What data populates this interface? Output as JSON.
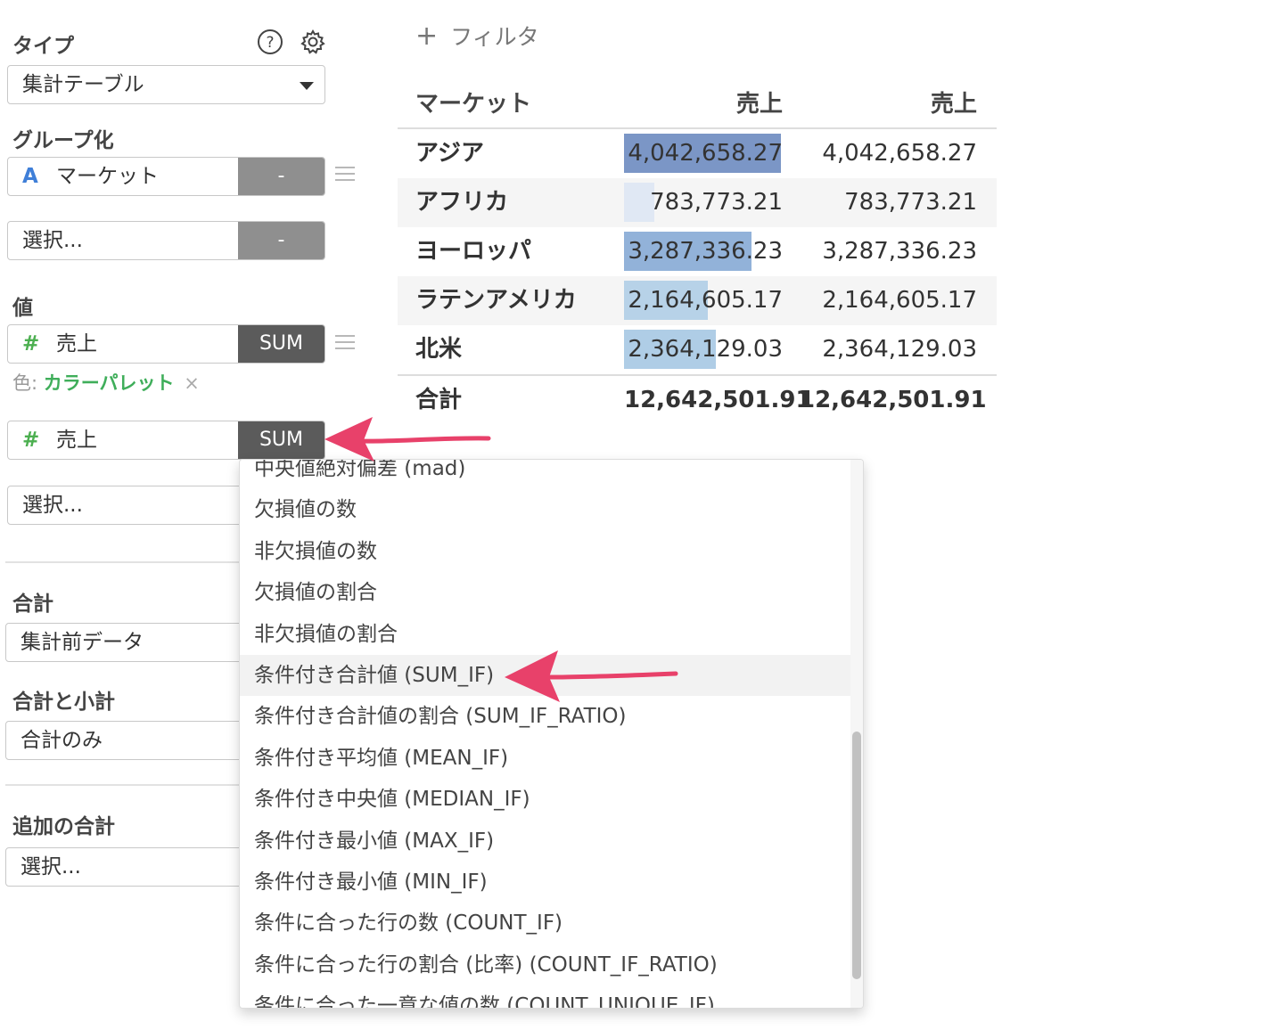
{
  "panel": {
    "type_label": "タイプ",
    "type_value": "集計テーブル",
    "group_label": "グループ化",
    "group_field": {
      "type_icon": "A",
      "name": "マーケット",
      "agg": "-"
    },
    "group_select": {
      "placeholder": "選択...",
      "agg": "-"
    },
    "value_label": "値",
    "value_field1": {
      "type_icon": "#",
      "name": "売上",
      "agg": "SUM"
    },
    "color_prefix": "色: ",
    "color_value": "カラーパレット",
    "color_remove": "×",
    "value_field2": {
      "type_icon": "#",
      "name": "売上",
      "agg": "SUM"
    },
    "value_select": {
      "placeholder": "選択..."
    },
    "total_label": "合計",
    "total_value": "集計前データ",
    "subtotal_label": "合計と小計",
    "subtotal_value": "合計のみ",
    "extra_total_label": "追加の合計",
    "extra_total_value": "選択..."
  },
  "filter": {
    "icon": "+",
    "label": "フィルタ"
  },
  "table": {
    "headers": [
      "マーケット",
      "売上",
      "売上"
    ],
    "rows": [
      {
        "market": "アジア",
        "v1": "4,042,658.27",
        "v2": "4,042,658.27",
        "bar_fraction": 1.0,
        "bar_color": "#7b96c6"
      },
      {
        "market": "アフリカ",
        "v1": "783,773.21",
        "v2": "783,773.21",
        "bar_fraction": 0.194,
        "bar_color": "#e0e8f4"
      },
      {
        "market": "ヨーロッパ",
        "v1": "3,287,336.23",
        "v2": "3,287,336.23",
        "bar_fraction": 0.813,
        "bar_color": "#92b2d9"
      },
      {
        "market": "ラテンアメリカ",
        "v1": "2,164,605.17",
        "v2": "2,164,605.17",
        "bar_fraction": 0.535,
        "bar_color": "#b7d2e8"
      },
      {
        "market": "北米",
        "v1": "2,364,129.03",
        "v2": "2,364,129.03",
        "bar_fraction": 0.585,
        "bar_color": "#afcde6"
      }
    ],
    "total": {
      "label": "合計",
      "v1": "12,642,501.91",
      "v2": "12,642,501.91"
    }
  },
  "dropdown": {
    "items": [
      "中央値絶対偏差 (mad)",
      "欠損値の数",
      "非欠損値の数",
      "欠損値の割合",
      "非欠損値の割合",
      "条件付き合計値 (SUM_IF)",
      "条件付き合計値の割合 (SUM_IF_RATIO)",
      "条件付き平均値 (MEAN_IF)",
      "条件付き中央値 (MEDIAN_IF)",
      "条件付き最小値 (MAX_IF)",
      "条件付き最小値 (MIN_IF)",
      "条件に合った行の数 (COUNT_IF)",
      "条件に合った行の割合 (比率) (COUNT_IF_RATIO)",
      "条件に合った一意な値の数 (COUNT_UNIQUE_IF)"
    ],
    "active_index": 5
  },
  "colors": {
    "accent_arrow": "#e8416a",
    "string_type": "#3f7fd8",
    "number_type": "#4caf50",
    "color_link": "#3fae5a"
  }
}
